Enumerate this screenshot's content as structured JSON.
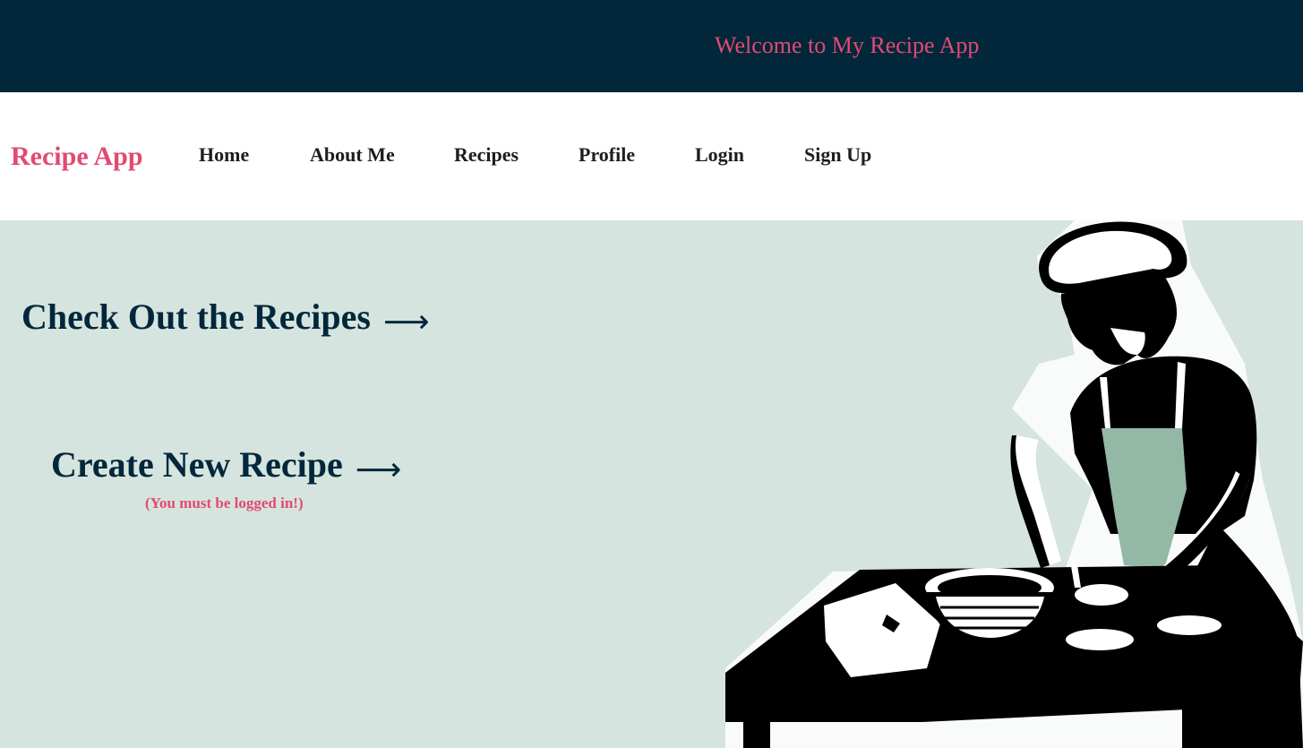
{
  "header": {
    "welcome_text": "Welcome to My Recipe App"
  },
  "nav": {
    "brand": "Recipe App",
    "links": [
      "Home",
      "About Me",
      "Recipes",
      "Profile",
      "Login",
      "Sign Up"
    ]
  },
  "hero": {
    "check_recipes_label": "Check Out the Recipes",
    "create_recipe_label": "Create New Recipe",
    "arrow_glyph": "⟶",
    "login_note": "(You must be logged in!)"
  },
  "colors": {
    "header_bg": "#03273a",
    "accent_pink": "#e24a72",
    "hero_bg": "#d5e4df",
    "apron_green": "#94b8a6"
  },
  "icons": {
    "arrow": "right-arrow-icon",
    "illustration": "chef-baking-illustration"
  }
}
